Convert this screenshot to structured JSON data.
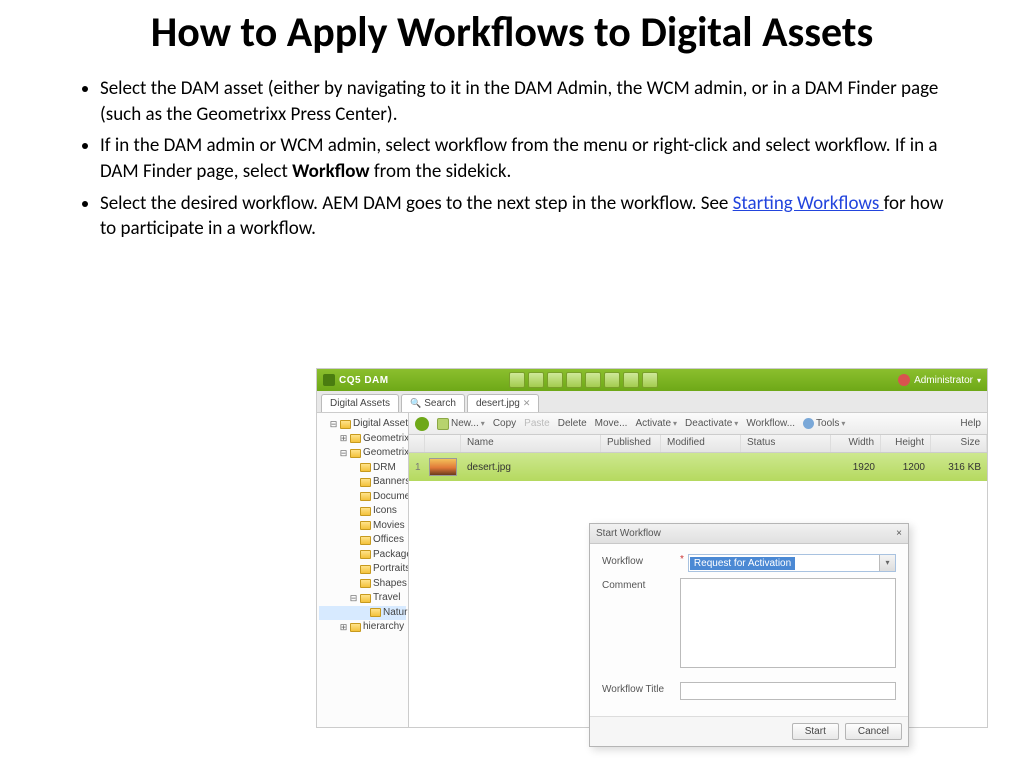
{
  "title": "How to Apply Workflows to Digital Assets",
  "bullets": {
    "b1": "Select the DAM asset (either by navigating to it in the DAM Admin, the WCM admin, or in a DAM Finder page (such as the Geometrixx Press Center).",
    "b2a": "If in the DAM admin or WCM admin, select workflow from the menu or right-click and select workflow. If in a DAM Finder page, select ",
    "b2b": "Workflow",
    "b2c": " from the sidekick.",
    "b3a": "Select the desired workflow. AEM DAM goes to the next step in the workflow. See ",
    "b3link": "Starting Workflows ",
    "b3b": "for how to participate in a workflow."
  },
  "app": {
    "brand": "CQ5 DAM",
    "admin": "Administrator",
    "tabs": {
      "t1": "Digital Assets",
      "t2": "Search",
      "t3": "desert.jpg"
    },
    "tree": {
      "root": "Digital Assets",
      "n1": "Geometrixx Outdoors",
      "n2": "Geometrixx",
      "n2a": "DRM",
      "n2b": "Banners",
      "n2c": "Documents",
      "n2d": "Icons",
      "n2e": "Movies",
      "n2f": "Offices",
      "n2g": "Package Shots",
      "n2h": "Portraits",
      "n2i": "Shapes",
      "n2j": "Travel",
      "n2j1": "Nature",
      "n3": "hierarchy"
    },
    "toolbar": {
      "new": "New...",
      "copy": "Copy",
      "paste": "Paste",
      "delete": "Delete",
      "move": "Move...",
      "activate": "Activate",
      "deactivate": "Deactivate",
      "workflow": "Workflow...",
      "tools": "Tools",
      "help": "Help"
    },
    "cols": {
      "name": "Name",
      "pub": "Published",
      "mod": "Modified",
      "stat": "Status",
      "w": "Width",
      "h": "Height",
      "sz": "Size"
    },
    "row": {
      "num": "1",
      "name": "desert.jpg",
      "w": "1920",
      "h": "1200",
      "sz": "316 KB"
    },
    "dialog": {
      "title": "Start Workflow",
      "close": "×",
      "workflow_lbl": "Workflow",
      "workflow_val": "Request for Activation",
      "comment_lbl": "Comment",
      "wtitle_lbl": "Workflow Title",
      "start": "Start",
      "cancel": "Cancel"
    }
  }
}
